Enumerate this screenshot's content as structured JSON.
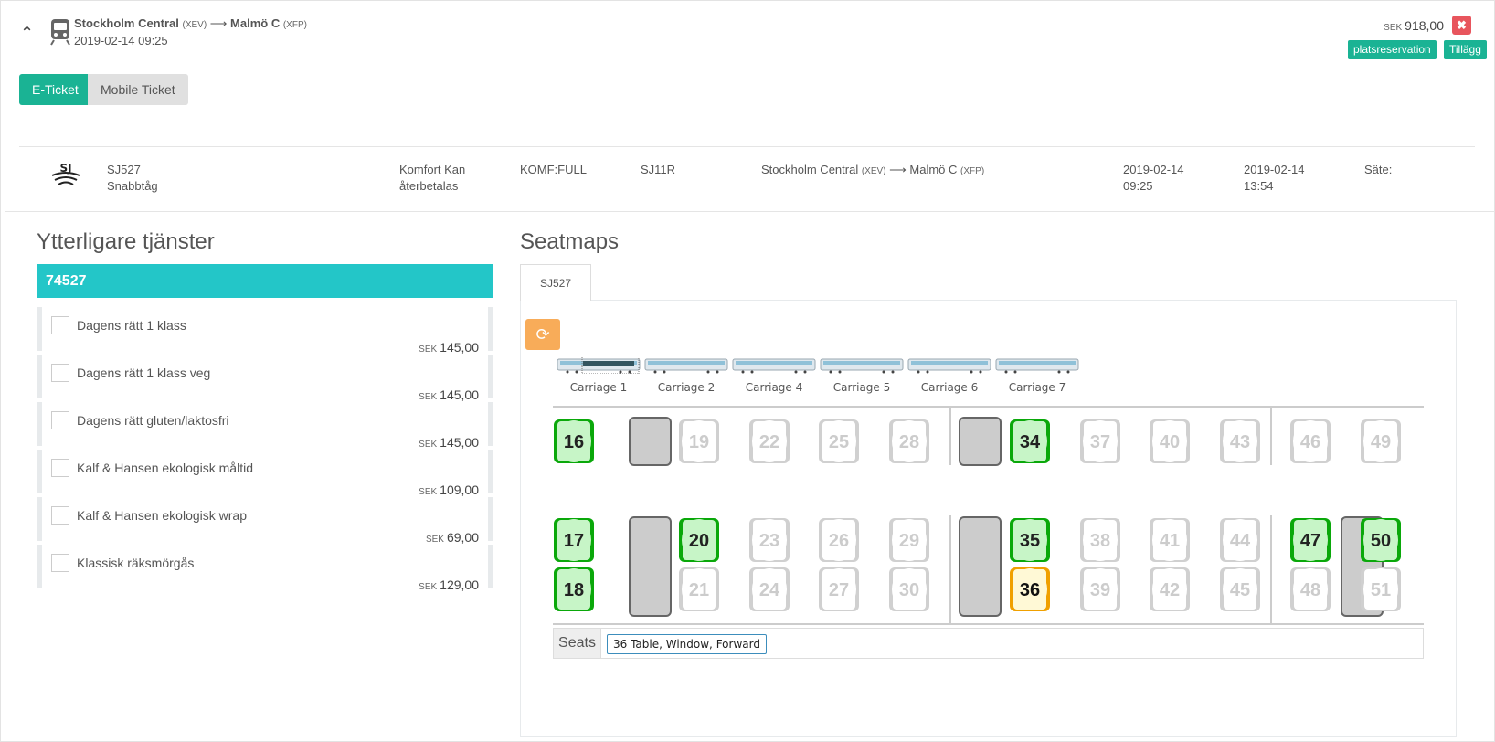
{
  "journey": {
    "from": "Stockholm Central",
    "from_code": "(XEV)",
    "arrow": "⟶",
    "to": "Malmö C",
    "to_code": "(XFP)",
    "datetime": "2019-02-14 09:25",
    "price_currency": "SEK",
    "price": "918,00",
    "remove_icon": "✖",
    "tags": [
      "platsreservation",
      "Tillägg"
    ]
  },
  "ticket_tabs": [
    "E-Ticket",
    "Mobile Ticket"
  ],
  "segment": {
    "train": "SJ527",
    "train_type": "Snabbtåg",
    "class_line1": "Komfort Kan",
    "class_line2": "återbetalas",
    "fare_code": "KOMF:FULL",
    "product": "SJ11R",
    "from": "Stockholm Central",
    "from_code": "(XEV)",
    "arrow": "⟶",
    "to": "Malmö C",
    "to_code": "(XFP)",
    "dep_date": "2019-02-14",
    "dep_time": "09:25",
    "arr_date": "2019-02-14",
    "arr_time": "13:54",
    "seat_label": "Säte:"
  },
  "services": {
    "title": "Ytterligare tjänster",
    "header": "74527",
    "currency": "SEK",
    "items": [
      {
        "name": "Dagens rätt 1 klass",
        "price": "145,00"
      },
      {
        "name": "Dagens rätt 1 klass veg",
        "price": "145,00"
      },
      {
        "name": "Dagens rätt gluten/laktosfri",
        "price": "145,00"
      },
      {
        "name": "Kalf & Hansen ekologisk måltid",
        "price": "109,00"
      },
      {
        "name": "Kalf & Hansen ekologisk wrap",
        "price": "69,00"
      },
      {
        "name": "Klassisk räksmörgås",
        "price": "129,00"
      }
    ]
  },
  "seatmaps": {
    "title": "Seatmaps",
    "tab": "SJ527",
    "refresh_icon": "⟳",
    "carriages": [
      "Carriage 1",
      "Carriage 2",
      "Carriage 4",
      "Carriage 5",
      "Carriage 6",
      "Carriage 7"
    ],
    "seats_label": "Seats",
    "selected_seat": "36 Table, Window, Forward",
    "seat_numbers_top": [
      "16",
      "19",
      "22",
      "25",
      "28",
      "34",
      "37",
      "40",
      "43",
      "46",
      "49"
    ],
    "seat_numbers_middle": [
      "17",
      "20",
      "23",
      "26",
      "29",
      "35",
      "38",
      "41",
      "44",
      "47",
      "50"
    ],
    "seat_numbers_bottom": [
      "18",
      "21",
      "24",
      "27",
      "30",
      "36",
      "39",
      "42",
      "45",
      "48",
      "51"
    ],
    "available_seats": [
      "16",
      "17",
      "18",
      "20",
      "34",
      "35",
      "47",
      "50"
    ],
    "selected_seats": [
      "36"
    ],
    "colors": {
      "available": "#0aa80a",
      "available_fill": "#c7f5c7",
      "selected": "#f0a000",
      "selected_fill": "#fff9d6",
      "unavailable": "#d0d0d0",
      "table": "#cccccc"
    }
  }
}
